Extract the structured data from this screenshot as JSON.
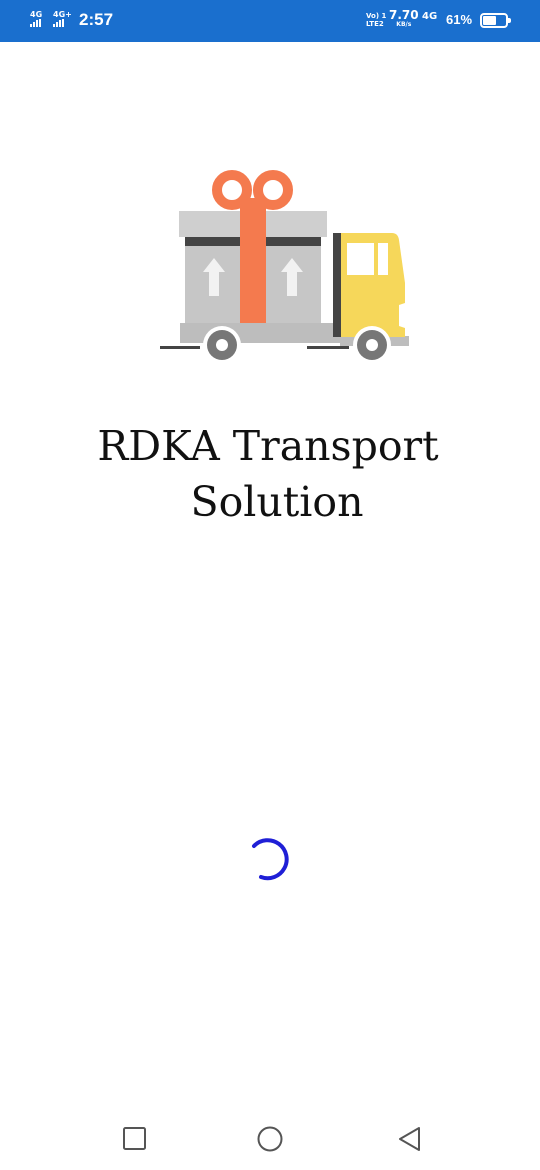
{
  "status_bar": {
    "sim1_label": "4G",
    "sim2_label": "4G+",
    "time": "2:57",
    "volte_label_top": "Vo) 1",
    "volte_label_bottom": "LTE2",
    "speed_value": "7.70",
    "speed_unit": "KB/s",
    "network_label": "4G",
    "battery_percent": "61%",
    "battery_level": 0.61,
    "background_color": "#1a6fce"
  },
  "splash": {
    "title_line1": "RDKA Transport",
    "title_line2": "Solution",
    "logo_icon": "delivery-truck-gift-icon",
    "logo_colors": {
      "box": "#c8c8c8",
      "ribbon": "#f47a4e",
      "cab": "#f6d75a",
      "wheel": "#757575",
      "strip": "#444444"
    }
  },
  "loading": {
    "spinner_icon": "loading-spinner-icon",
    "spinner_color": "#1f1fd6"
  },
  "nav_bar": {
    "recents_icon": "square-recents-icon",
    "home_icon": "circle-home-icon",
    "back_icon": "triangle-back-icon"
  }
}
